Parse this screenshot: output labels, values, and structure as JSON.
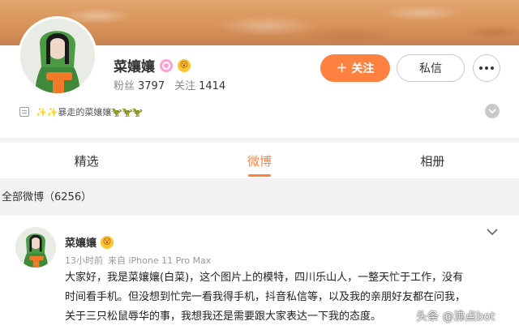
{
  "profile": {
    "name": "菜孃孃",
    "badge_icons": [
      "pink-circle-icon",
      "emoji-face-icon"
    ],
    "emoji_face": "😮",
    "stats": {
      "fans_label": "粉丝",
      "fans_value": "3797",
      "following_label": "关注",
      "following_value": "1414"
    },
    "follow_button": "＋ 关注",
    "message_button": "私信",
    "more_icon": "more-dots-icon",
    "bio": {
      "sparkle": "✨✨",
      "text": "暴走的菜孃孃",
      "plant_icons": "🦖🦖🦖"
    }
  },
  "tabs": [
    {
      "label": "精选",
      "active": false
    },
    {
      "label": "微博",
      "active": true
    },
    {
      "label": "相册",
      "active": false
    }
  ],
  "section_title": "全部微博（6256）",
  "post": {
    "author": "菜孃孃",
    "time": "13小时前",
    "source": "来自 iPhone 11 Pro Max",
    "lines": [
      "大家好，我是菜孃孃(白菜)，这个图片上的模特，四川乐山人，一整天忙于工作，没有",
      "时间看手机。但没想到忙完一看我得手机，抖音私信等，以及我的亲朋好友都在问我，",
      "关于三只松鼠辱华的事，我想我还是需要跟大家表达一下我的态度。"
    ]
  },
  "watermark": "头条 @沸点bot",
  "colors": {
    "accent": "#ff8140",
    "banner": "#d8935a"
  }
}
